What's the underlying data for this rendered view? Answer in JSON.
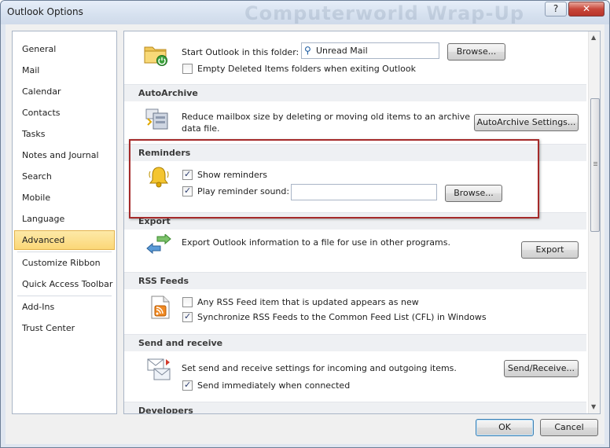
{
  "window": {
    "title": "Outlook Options",
    "background_title": "Computerworld Wrap-Up",
    "help_glyph": "?",
    "close_glyph": "✕"
  },
  "sidebar": {
    "items": [
      {
        "label": "General"
      },
      {
        "label": "Mail"
      },
      {
        "label": "Calendar"
      },
      {
        "label": "Contacts"
      },
      {
        "label": "Tasks"
      },
      {
        "label": "Notes and Journal"
      },
      {
        "label": "Search"
      },
      {
        "label": "Mobile"
      },
      {
        "label": "Language"
      },
      {
        "label": "Advanced",
        "selected": true
      },
      {
        "label": "Customize Ribbon"
      },
      {
        "label": "Quick Access Toolbar"
      },
      {
        "label": "Add-Ins"
      },
      {
        "label": "Trust Center"
      }
    ]
  },
  "outlook_start": {
    "start_label": "Start Outlook in this folder:",
    "folder_value": "Unread Mail",
    "browse_label": "Browse...",
    "empty_deleted_label": "Empty Deleted Items folders when exiting Outlook",
    "empty_deleted_checked": false
  },
  "autoarchive": {
    "header": "AutoArchive",
    "description_line1": "Reduce mailbox size by deleting or moving old items to an archive",
    "description_line2": "data file.",
    "settings_button": "AutoArchive Settings..."
  },
  "reminders": {
    "header": "Reminders",
    "show_label": "Show reminders",
    "show_checked": true,
    "play_label": "Play reminder sound:",
    "play_checked": true,
    "sound_value": "",
    "browse_label": "Browse..."
  },
  "export": {
    "header": "Export",
    "description": "Export Outlook information to a file for use in other programs.",
    "button": "Export"
  },
  "rss": {
    "header": "RSS Feeds",
    "any_feed_label": "Any RSS Feed item that is updated appears as new",
    "any_feed_checked": false,
    "sync_label": "Synchronize RSS Feeds to the Common Feed List (CFL) in Windows",
    "sync_checked": true
  },
  "send_receive": {
    "header": "Send and receive",
    "description": "Set send and receive settings for incoming and outgoing items.",
    "button": "Send/Receive...",
    "send_immediately_label": "Send immediately when connected",
    "send_immediately_checked": true
  },
  "developers": {
    "header": "Developers"
  },
  "footer": {
    "ok": "OK",
    "cancel": "Cancel"
  },
  "colors": {
    "selected_nav": "#fbd777",
    "highlight_border": "#a52a2a",
    "section_header_bg": "#eef0f3"
  }
}
